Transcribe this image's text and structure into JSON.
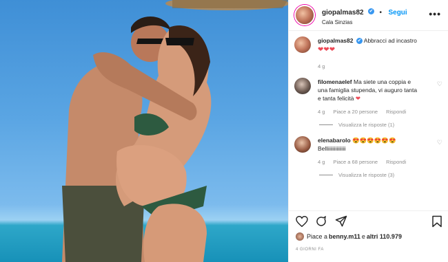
{
  "post": {
    "username": "giopalmas82",
    "location": "Cala Sinzias",
    "follow_label": "Segui",
    "more_label": "•••",
    "verified_glyph": "✔"
  },
  "caption": {
    "username": "giopalmas82",
    "text": "Abbracci ad incastro",
    "hearts": "❤❤❤",
    "time": "4 g"
  },
  "comments": [
    {
      "username": "filomenaelef",
      "text": "Ma siete una coppia e una famiglia stupenda, vi auguro tanta e tanta felicità ",
      "emoji": "❤",
      "time": "4 g",
      "likes": "Piace a 20 persone",
      "reply_label": "Rispondi",
      "view_replies": "Visualizza le risposte (1)"
    },
    {
      "username": "elenabarolo",
      "text": "😍😍😍😍😍😍",
      "text2": "Belliiiiiiiiiiiiii",
      "time": "4 g",
      "likes": "Piace a 68 persone",
      "reply_label": "Rispondi",
      "view_replies": "Visualizza le risposte (3)"
    }
  ],
  "likes": {
    "prefix": "Piace a ",
    "user": "benny.m11",
    "mid": " e ",
    "others": "altri 110.979"
  },
  "date": "4 GIORNI FA",
  "icons": [
    "heart-icon",
    "comment-icon",
    "share-icon",
    "bookmark-icon"
  ],
  "colors": {
    "accent": "#0095f6",
    "verified": "#3897f0",
    "heart": "#ed4956"
  }
}
